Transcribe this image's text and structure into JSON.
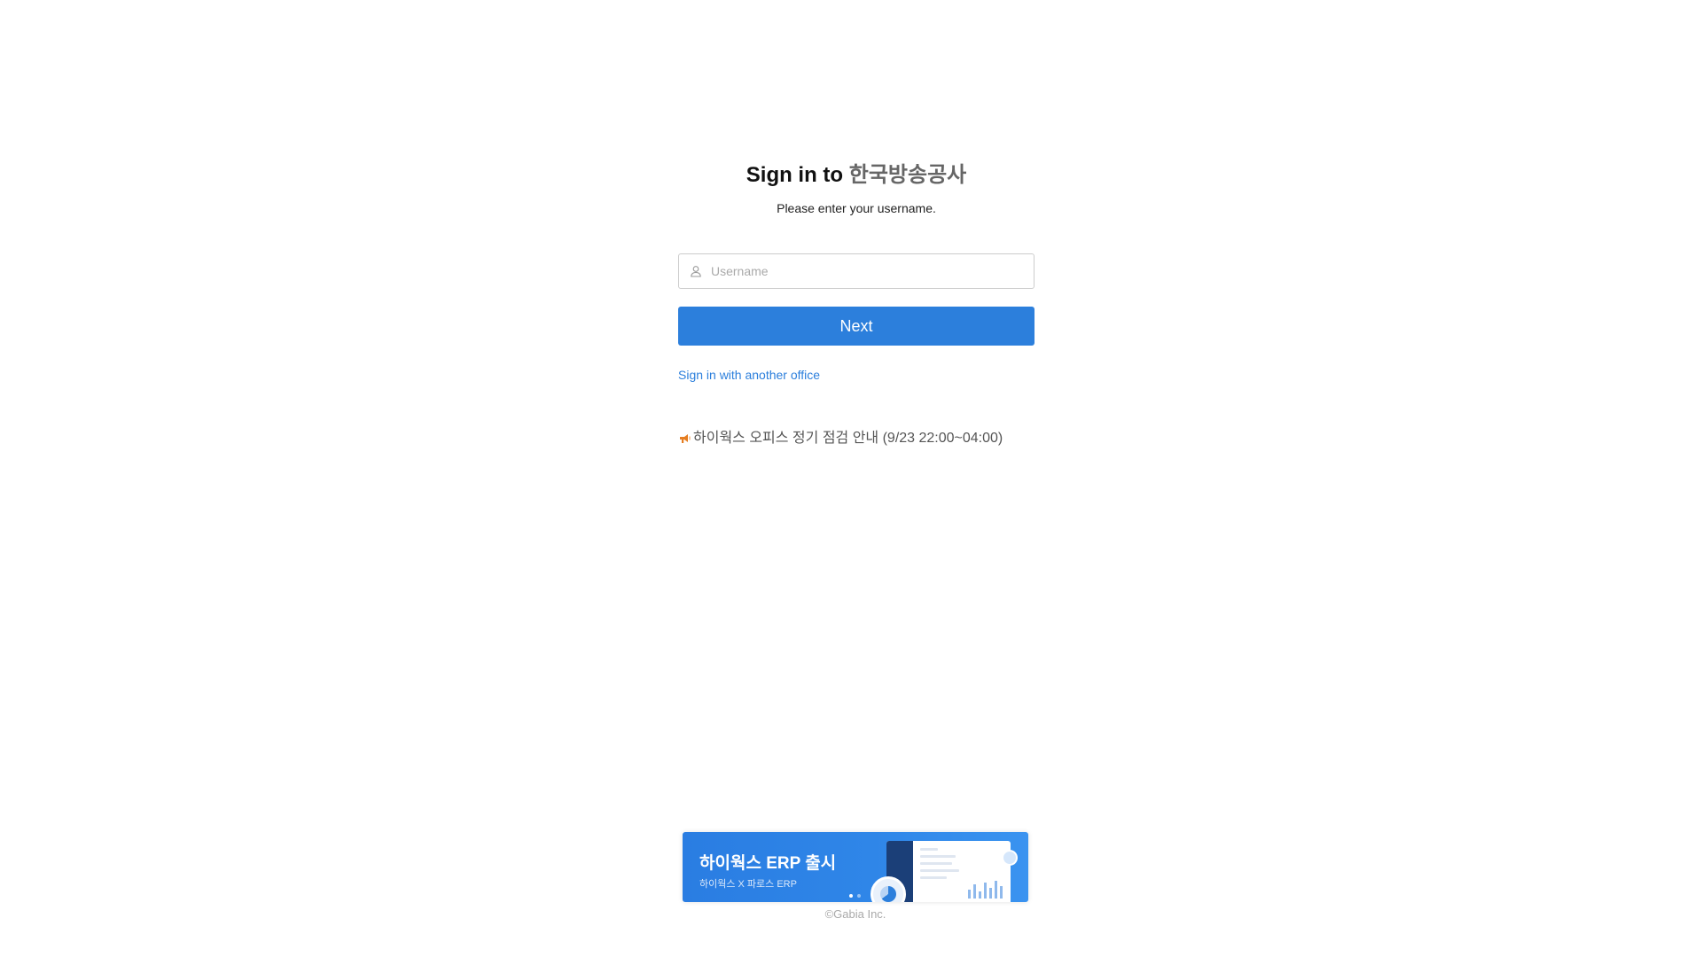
{
  "header": {
    "title_prefix": "Sign in to ",
    "organization": "한국방송공사",
    "subtitle": "Please enter your username."
  },
  "login_form": {
    "username_placeholder": "Username",
    "username_value": "",
    "next_label": "Next",
    "other_office_link": "Sign in with another office"
  },
  "notice": {
    "icon": "megaphone-icon",
    "text": "하이웍스 오피스 정기 점검 안내 (9/23 22:00~04:00)"
  },
  "banner": {
    "title": "하이웍스 ERP 출시",
    "subtitle": "하이웍스 X 파로스 ERP"
  },
  "footer": {
    "copyright": "©Gabia Inc."
  },
  "colors": {
    "accent": "#2c7fdc",
    "notice_icon": "#e67e22"
  }
}
